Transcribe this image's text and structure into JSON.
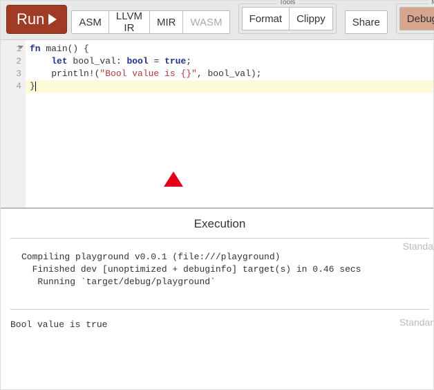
{
  "toolbar": {
    "run_label": "Run",
    "asm_label": "ASM",
    "llvm_label": "LLVM IR",
    "mir_label": "MIR",
    "wasm_label": "WASM",
    "tools_group_label": "Tools",
    "format_label": "Format",
    "clippy_label": "Clippy",
    "share_label": "Share",
    "mode_group_label": "Mo",
    "debug_label": "Debug"
  },
  "editor": {
    "gutter": [
      "1",
      "2",
      "3",
      "4"
    ],
    "code": {
      "l1": {
        "a": "fn",
        "b": " main() {"
      },
      "l2": {
        "a": "    ",
        "b": "let",
        "c": " bool_val: ",
        "d": "bool",
        "e": " = ",
        "f": "true",
        "g": ";"
      },
      "l3": {
        "a": "    println!(",
        "b": "\"Bool value is {}\"",
        "c": ", bool_val);"
      },
      "l4": {
        "a": "}"
      }
    }
  },
  "output": {
    "title": "Execution",
    "stderr_label": "Standa",
    "stdout_label": "Standar",
    "compile_block": "Compiling playground v0.0.1 (file:///playground)\n  Finished dev [unoptimized + debuginfo] target(s) in 0.46 secs\n   Running `target/debug/playground`",
    "stdout_block": "Bool value is true"
  }
}
